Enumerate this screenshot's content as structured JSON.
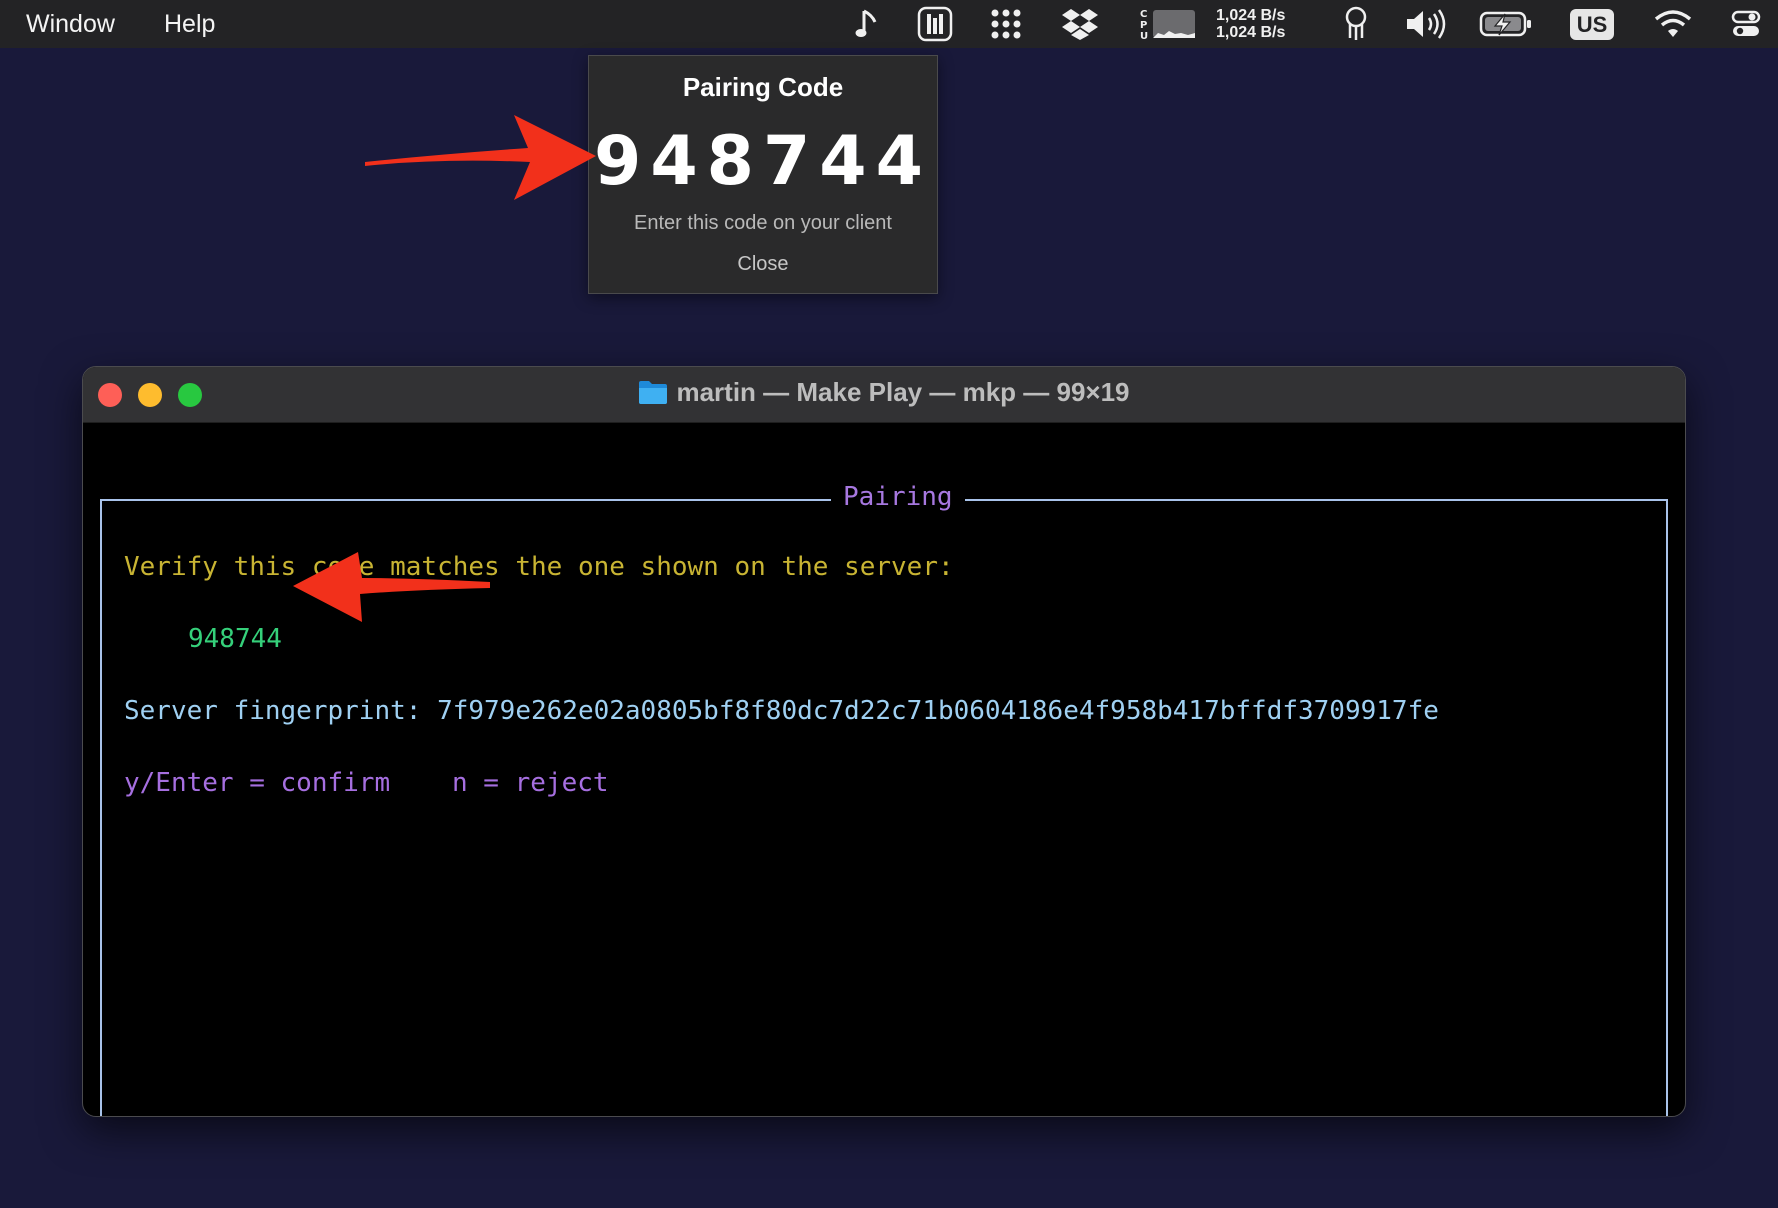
{
  "menubar": {
    "items": [
      "Window",
      "Help"
    ],
    "network": {
      "upload": "1,024 B/s",
      "download": "1,024 B/s"
    },
    "cpu_label": "C\nP\nU",
    "keyboard_layout": "US",
    "tray_icons": [
      "music-note-icon",
      "audio-meter-icon",
      "launchpad-dots-icon",
      "dropbox-icon",
      "cpu-graph-icon",
      "keychain-icon",
      "volume-icon",
      "battery-charging-icon",
      "input-source-icon",
      "wifi-icon",
      "control-center-icon"
    ]
  },
  "popup": {
    "title": "Pairing Code",
    "code": "948744",
    "hint": "Enter this code on your client",
    "close_label": "Close"
  },
  "terminal": {
    "title": "martin — Make Play — mkp — 99×19",
    "frame_label": "Pairing",
    "verify_line": "Verify this code matches the one shown on the server:",
    "code": "948744",
    "fingerprint_line": "Server fingerprint: 7f979e262e02a0805bf8f80dc7d22c71b0604186e4f958b417bffdf3709917fe",
    "confirm_hint": "y/Enter = confirm",
    "reject_hint": "n = reject"
  },
  "colors": {
    "desktop": "#19193a",
    "arrow": "#f2301b",
    "verify_text": "#c8b433",
    "code_text": "#35d07a",
    "fingerprint_text": "#9fd0f2",
    "hint_text": "#a66fe0",
    "frame_border": "#a9c3ea"
  }
}
